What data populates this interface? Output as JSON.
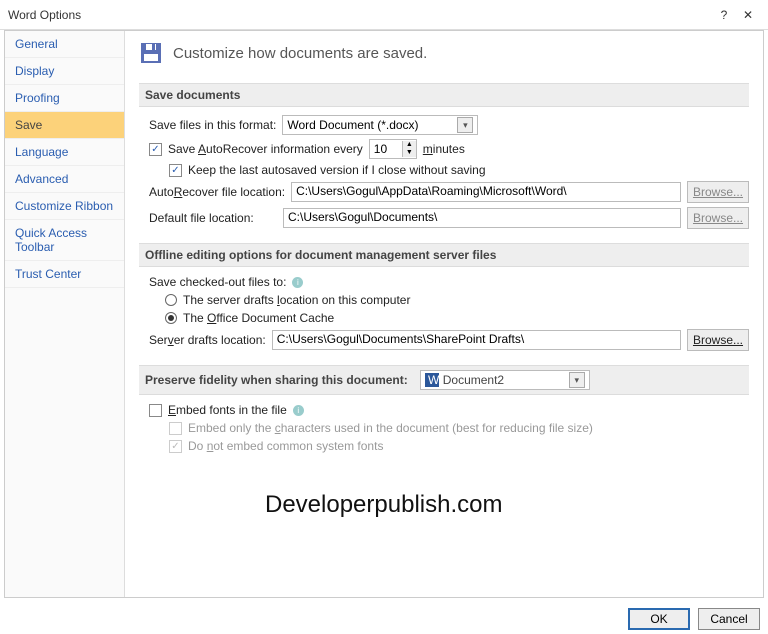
{
  "title": "Word Options",
  "sidebar": {
    "items": [
      {
        "label": "General"
      },
      {
        "label": "Display"
      },
      {
        "label": "Proofing"
      },
      {
        "label": "Save"
      },
      {
        "label": "Language"
      },
      {
        "label": "Advanced"
      },
      {
        "label": "Customize Ribbon"
      },
      {
        "label": "Quick Access Toolbar"
      },
      {
        "label": "Trust Center"
      }
    ]
  },
  "main": {
    "heading": "Customize how documents are saved.",
    "sec1": "Save documents",
    "save_format_lbl": "Save files in this format:",
    "save_format_val": "Word Document (*.docx)",
    "autorecover_lbl": "Save AutoRecover information every",
    "autorecover_val": "10",
    "minutes_lbl": "minutes",
    "keep_last_lbl": "Keep the last autosaved version if I close without saving",
    "autorecover_loc_lbl": "AutoRecover file location:",
    "autorecover_loc_val": "C:\\Users\\Gogul\\AppData\\Roaming\\Microsoft\\Word\\",
    "default_loc_lbl": "Default file location:",
    "default_loc_val": "C:\\Users\\Gogul\\Documents\\",
    "browse_lbl": "Browse...",
    "sec2": "Offline editing options for document management server files",
    "checkedout_lbl": "Save checked-out files to:",
    "radio1": "The server drafts location on this computer",
    "radio2": "The Office Document Cache",
    "server_drafts_lbl": "Server drafts location:",
    "server_drafts_val": "C:\\Users\\Gogul\\Documents\\SharePoint Drafts\\",
    "sec3": "Preserve fidelity when sharing this document:",
    "doc_sel": "Document2",
    "embed_lbl": "Embed fonts in the file",
    "embed_sub1": "Embed only the characters used in the document (best for reducing file size)",
    "embed_sub2": "Do not embed common system fonts",
    "watermark": "Developerpublish.com",
    "ok": "OK",
    "cancel": "Cancel"
  }
}
